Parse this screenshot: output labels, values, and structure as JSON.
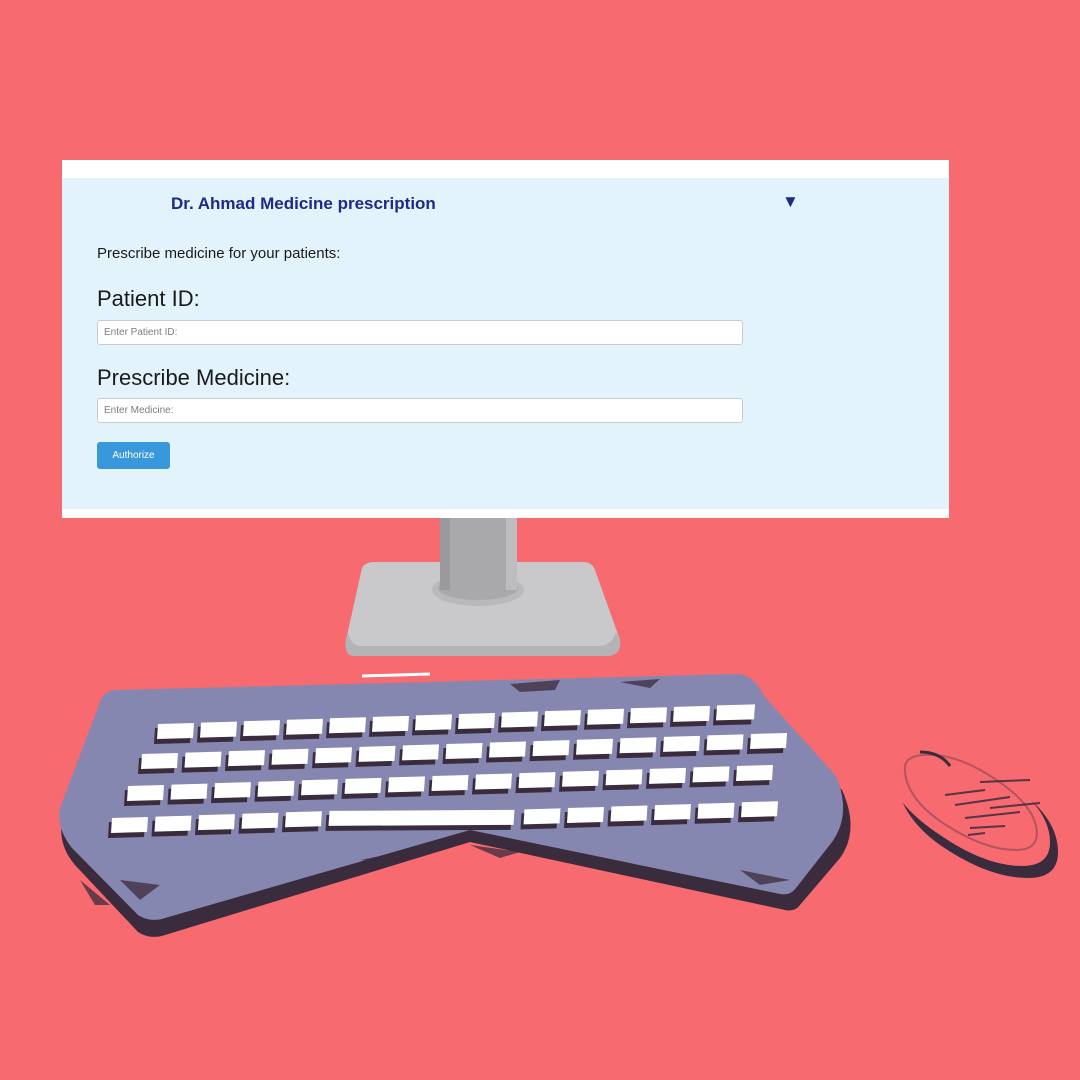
{
  "colors": {
    "background": "#f66a70",
    "panel": "#e3f3fc",
    "title": "#1d2a87",
    "button": "#3798dc",
    "keyboard": "#8687b0",
    "keyboard_shadow": "#3a2b3d"
  },
  "app": {
    "title": "Dr. Ahmad Medicine prescription",
    "toggle_icon": "caret-down-icon",
    "toggle_glyph": "▼",
    "intro": "Prescribe medicine for your patients:"
  },
  "form": {
    "patient_id": {
      "label": "Patient ID:",
      "value": "",
      "placeholder": "Enter Patient ID:"
    },
    "medicine": {
      "label": "Prescribe Medicine:",
      "value": "",
      "placeholder": "Enter Medicine:"
    },
    "submit_label": "Authorize"
  },
  "illustration": {
    "objects": [
      "monitor-stand",
      "keyboard",
      "mouse"
    ]
  }
}
